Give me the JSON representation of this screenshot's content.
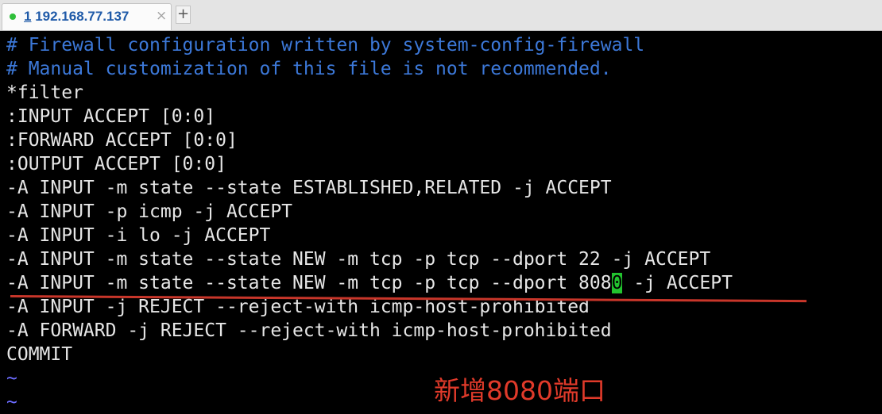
{
  "tab": {
    "index": "1",
    "title": " 192.168.77.137",
    "close_glyph": "×",
    "add_glyph": "+",
    "status_color": "#2fbf3a"
  },
  "terminal": {
    "lines": [
      "# Firewall configuration written by system-config-firewall",
      "# Manual customization of this file is not recommended.",
      "*filter",
      ":INPUT ACCEPT [0:0]",
      ":FORWARD ACCEPT [0:0]",
      ":OUTPUT ACCEPT [0:0]",
      "-A INPUT -m state --state ESTABLISHED,RELATED -j ACCEPT",
      "-A INPUT -p icmp -j ACCEPT",
      "-A INPUT -i lo -j ACCEPT",
      "-A INPUT -m state --state NEW -m tcp -p tcp --dport 22 -j ACCEPT",
      "-A INPUT -m state --state NEW -m tcp -p tcp --dport 808",
      "0",
      " -j ACCEPT",
      "-A INPUT -j REJECT --reject-with icmp-host-prohibited",
      "-A FORWARD -j REJECT --reject-with icmp-host-prohibited",
      "COMMIT",
      "~",
      "~"
    ],
    "comment_color": "#3c78d8",
    "cursor_color": "#22c32e"
  },
  "annotation": {
    "text": "新增8080端口",
    "color": "#e03a2a"
  }
}
